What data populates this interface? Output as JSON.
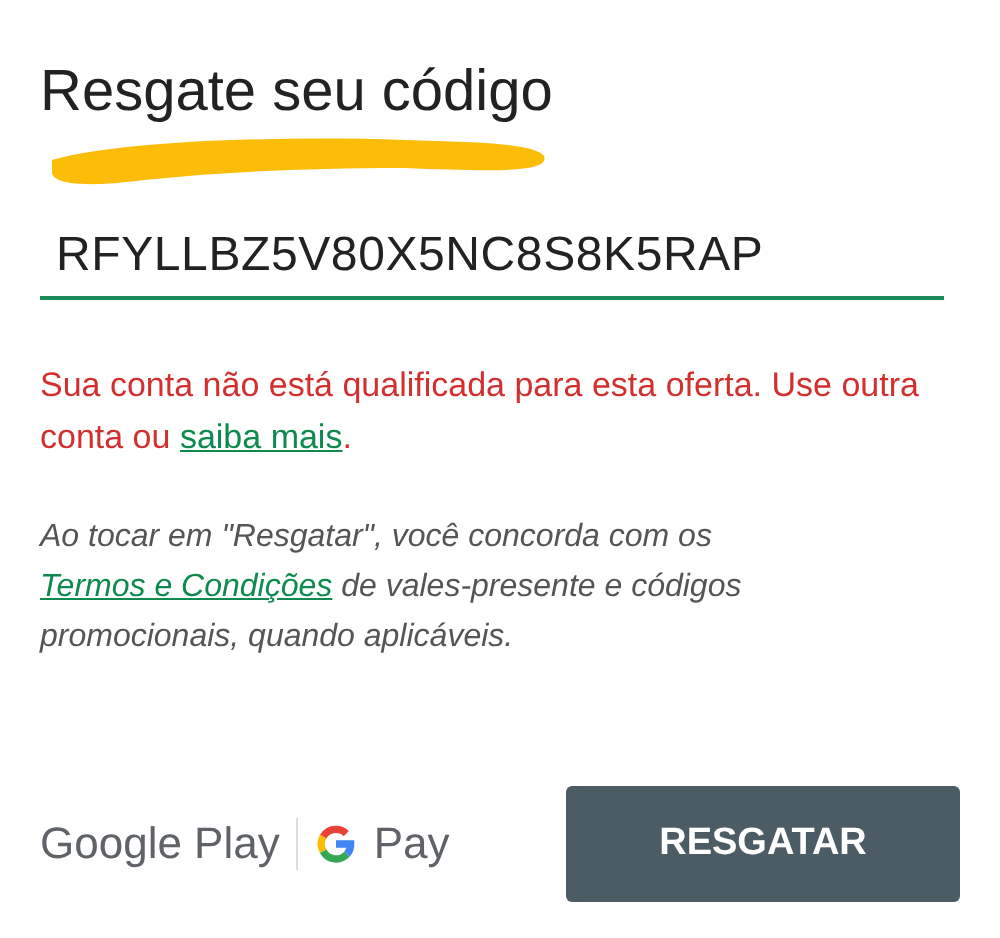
{
  "title": "Resgate seu código",
  "account": {
    "kind": "redacted"
  },
  "code_field": {
    "value": "RFYLLBZ5V80X5NC8S8K5RAP"
  },
  "error": {
    "text": "Sua conta não está qualificada para esta oferta. Use outra conta ou ",
    "link": "saiba mais",
    "after": "."
  },
  "terms": {
    "before": "Ao tocar em \"Resgatar\", você concorda com os ",
    "link": "Termos e Condições",
    "after": " de vales-presente e códigos promocionais, quando aplicáveis."
  },
  "brand": {
    "play": "Google Play",
    "pay": "Pay"
  },
  "button": "RESGATAR"
}
